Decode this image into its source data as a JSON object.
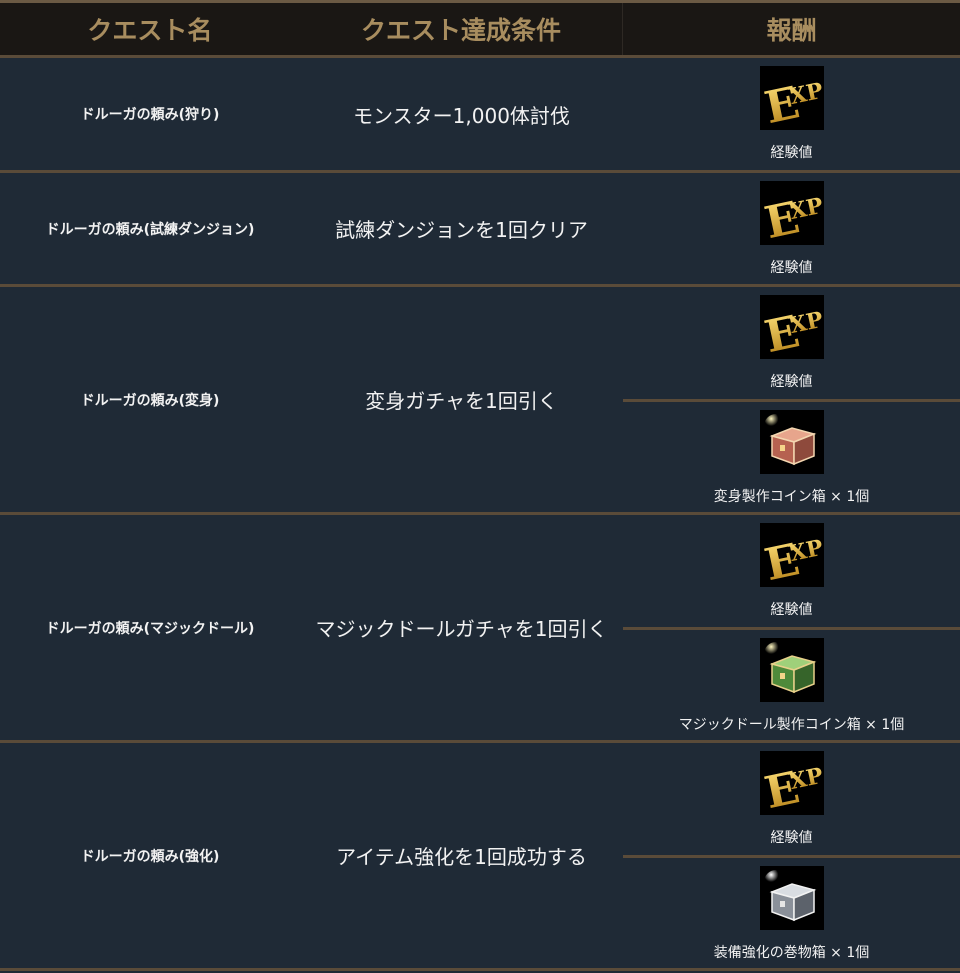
{
  "header": {
    "col_name": "クエスト名",
    "col_condition": "クエスト達成条件",
    "col_reward": "報酬"
  },
  "rows": [
    {
      "name": "ドルーガの頼み(狩り)",
      "condition": "モンスター1,000体討伐",
      "rewards": [
        {
          "icon": "exp-icon",
          "label": "経験値"
        }
      ]
    },
    {
      "name": "ドルーガの頼み(試練ダンジョン)",
      "condition": "試練ダンジョンを1回クリア",
      "rewards": [
        {
          "icon": "exp-icon",
          "label": "経験値"
        }
      ]
    },
    {
      "name": "ドルーガの頼み(変身)",
      "condition": "変身ガチャを1回引く",
      "rewards": [
        {
          "icon": "exp-icon",
          "label": "経験値"
        },
        {
          "icon": "copper-chest-icon",
          "label": "変身製作コイン箱 × 1個"
        }
      ]
    },
    {
      "name": "ドルーガの頼み(マジックドール)",
      "condition": "マジックドールガチャを1回引く",
      "rewards": [
        {
          "icon": "exp-icon",
          "label": "経験値"
        },
        {
          "icon": "green-chest-icon",
          "label": "マジックドール製作コイン箱 × 1個"
        }
      ]
    },
    {
      "name": "ドルーガの頼み(強化)",
      "condition": "アイテム強化を1回成功する",
      "rewards": [
        {
          "icon": "exp-icon",
          "label": "経験値"
        },
        {
          "icon": "silver-chest-icon",
          "label": "装備強化の巻物箱 × 1個"
        }
      ]
    }
  ],
  "colors": {
    "header_text": "#a88d5f",
    "row_bg": "#1f2a36",
    "divider": "#5a4b39"
  }
}
